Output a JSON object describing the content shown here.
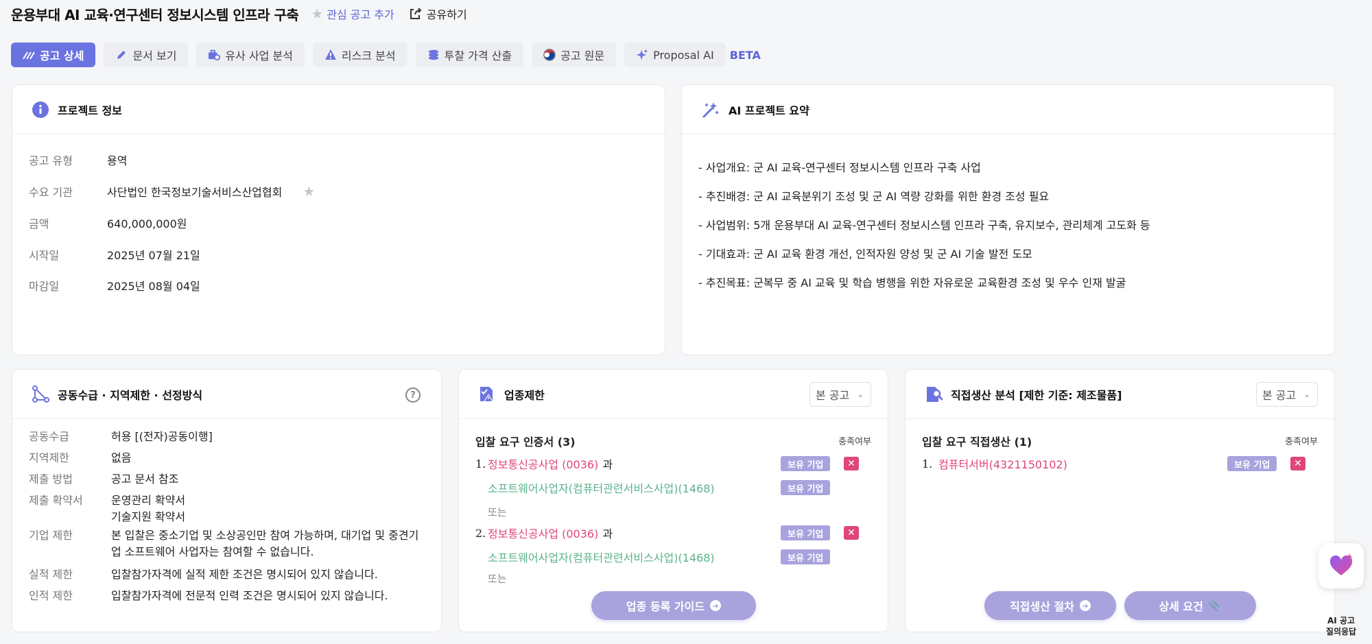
{
  "header": {
    "title": "운용부대 AI 교육·연구센터 정보시스템 인프라 구축",
    "favorite_label": "관심 공고 추가",
    "share_label": "공유하기"
  },
  "tabs": [
    {
      "label": "공고 상세",
      "icon": "pen-lines-icon",
      "active": true
    },
    {
      "label": "문서 보기",
      "icon": "pencil-icon",
      "active": false
    },
    {
      "label": "유사 사업 분석",
      "icon": "briefcase-clock-icon",
      "active": false
    },
    {
      "label": "리스크 분석",
      "icon": "warning-icon",
      "active": false
    },
    {
      "label": "투찰 가격 산출",
      "icon": "coins-icon",
      "active": false
    },
    {
      "label": "공고 원문",
      "icon": "taegeuk-icon",
      "active": false
    },
    {
      "label": "Proposal AI",
      "icon": "sparkle-icon",
      "active": false
    }
  ],
  "beta_label": "BETA",
  "project_info": {
    "title": "프로젝트 정보",
    "rows": [
      {
        "key": "공고 유형",
        "value": "용역"
      },
      {
        "key": "수요 기관",
        "value": "사단법인 한국정보기술서비스산업협회"
      },
      {
        "key": "금액",
        "value": "640,000,000원"
      },
      {
        "key": "시작일",
        "value": "2025년 07월 21일"
      },
      {
        "key": "마감일",
        "value": "2025년 08월 04일"
      }
    ]
  },
  "ai_summary": {
    "title": "AI 프로젝트 요약",
    "lines": [
      "- 사업개요: 군 AI 교육-연구센터 정보시스템 인프라 구축 사업",
      "- 추진배경: 군 AI 교육분위기 조성 및 군 AI 역량 강화를 위한 환경 조성 필요",
      "- 사업범위: 5개 운용부대 AI 교육-연구센터 정보시스템 인프라 구축, 유지보수, 관리체계 고도화 등",
      "- 기대효과: 군 AI 교육 환경 개선, 인적자원 양성 및 군 AI 기술 발전 도모",
      "- 추진목표: 군복무 중 AI 교육 및 학습 병행을 위한 자유로운 교육환경 조성 및 우수 인재 발굴"
    ]
  },
  "joint": {
    "title": "공동수급 · 지역제한 · 선정방식",
    "rows": [
      {
        "key": "공동수급",
        "value": "허용 [(전자)공동이행]"
      },
      {
        "key": "지역제한",
        "value": "없음"
      },
      {
        "key": "제출 방법",
        "value": "공고 문서 참조"
      },
      {
        "key": "제출 확약서",
        "value": "운영관리 확약서",
        "value2": "기술지원 확약서"
      },
      {
        "key": "기업 제한",
        "value": "본 입찰은 중소기업 및 소상공인만 참여 가능하며, 대기업 및 중견기업 소프트웨어 사업자는 참여할 수 없습니다."
      },
      {
        "key": "실적 제한",
        "value": "입찰참가자격에 실적 제한 조건은 명시되어 있지 않습니다."
      },
      {
        "key": "인적 제한",
        "value": "입찰참가자격에 전문적 인력 조건은 명시되어 있지 않습니다."
      }
    ]
  },
  "industry": {
    "title": "업종제한",
    "select_value": "본 공고",
    "sub_title": "입찰 요구 인증서 (3)",
    "sub_right": "충족여부",
    "items": [
      {
        "num": "1.",
        "primary": "정보통신공사업 (0036)",
        "connector": "과",
        "secondary": "소프트웨어사업자(컴퓨터관련서비스사업)(1468)"
      },
      {
        "num": "2.",
        "primary": "정보통신공사업 (0036)",
        "connector": "과",
        "secondary": "소프트웨어사업자(컴퓨터관련서비스사업)(1468)"
      }
    ],
    "or_label": "또는",
    "or_label_2": "또는",
    "badge_label": "보유 기업",
    "guide_button": "업종 등록 가이드"
  },
  "direct": {
    "title": "직접생산 분석 [제한 기준: 제조물품]",
    "select_value": "본 공고",
    "sub_title": "입찰 요구 직접생산 (1)",
    "sub_right": "충족여부",
    "items": [
      {
        "num": "1.",
        "name": "컴퓨터서버(4321150102)"
      }
    ],
    "badge_label": "보유 기업",
    "procedure_button": "직접생산 절차",
    "detail_button": "상세 요건"
  },
  "fab": {
    "line1": "AI 공고",
    "line2": "질의응답"
  },
  "colors": {
    "accent": "#6b73e0",
    "badge": "#a8a3dd",
    "red": "#e0457b",
    "green": "#5ab38b"
  }
}
